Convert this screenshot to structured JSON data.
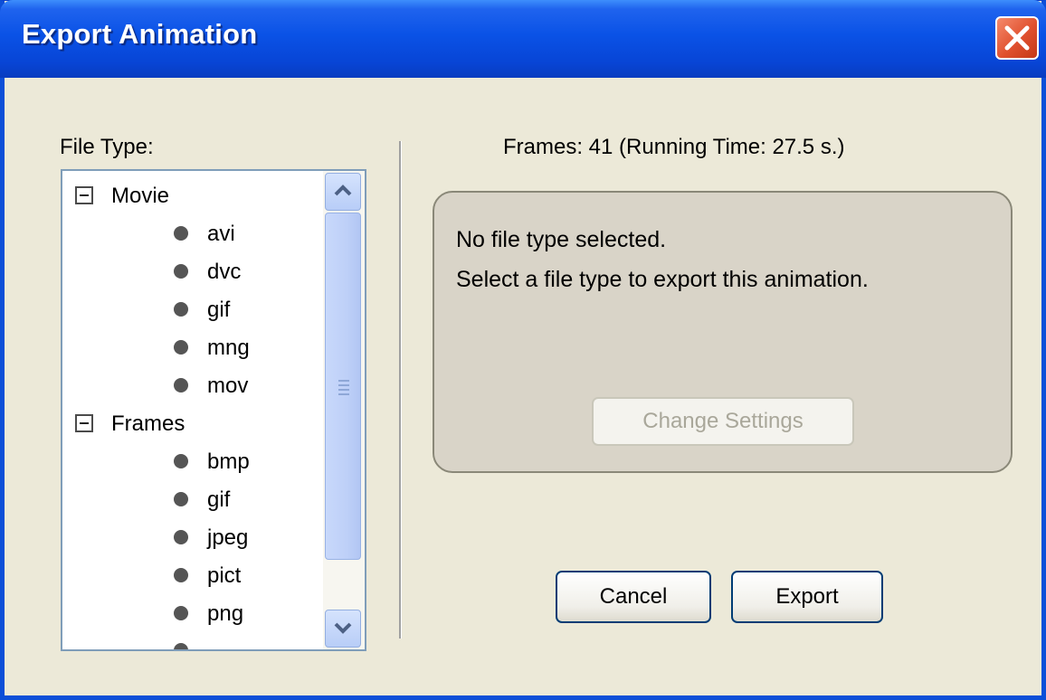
{
  "window": {
    "title": "Export Animation"
  },
  "file_type": {
    "label": "File Type:",
    "groups": [
      {
        "name": "Movie",
        "items": [
          "avi",
          "dvc",
          "gif",
          "mng",
          "mov"
        ]
      },
      {
        "name": "Frames",
        "items": [
          "bmp",
          "gif",
          "jpeg",
          "pict",
          "png"
        ]
      }
    ]
  },
  "frames_info": "Frames:  41  (Running Time: 27.5 s.)",
  "settings_panel": {
    "message_line1": "No file type selected.",
    "message_line2": "Select a file type to export this animation.",
    "change_settings_label": "Change Settings"
  },
  "buttons": {
    "cancel": "Cancel",
    "export": "Export"
  },
  "colors": {
    "titlebar": "#0a52e6",
    "dialog_bg": "#ece9d8",
    "close_button": "#e0502e",
    "button_border": "#003c74"
  }
}
